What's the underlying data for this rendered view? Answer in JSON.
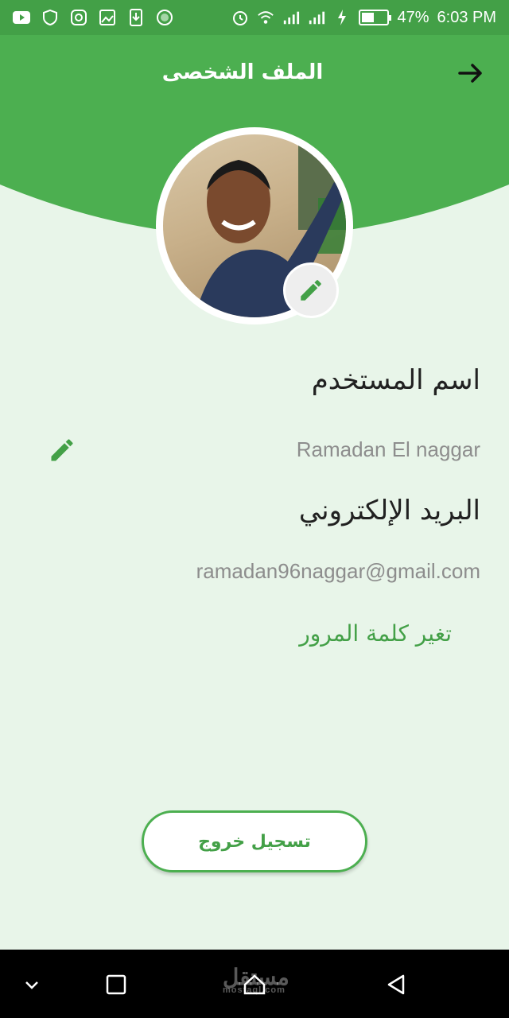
{
  "status_bar": {
    "battery_percent": "47%",
    "battery_level": 0.47,
    "time": "6:03 PM",
    "icons": [
      "youtube-icon",
      "shield-icon",
      "instagram-icon",
      "gallery-icon",
      "download-icon",
      "circle-app-icon"
    ],
    "right_icons": [
      "alarm-icon",
      "wifi-icon",
      "signal-icon",
      "signal-icon",
      "charging-icon",
      "battery-icon"
    ]
  },
  "header": {
    "title": "الملف الشخصى",
    "back_icon": "arrow-right-icon"
  },
  "profile": {
    "name_label": "اسم المستخدم",
    "name_value": "Ramadan El naggar",
    "email_label": "البريد الإلكتروني",
    "email_value": "ramadan96naggar@gmail.com",
    "change_password": "تغير كلمة المرور",
    "logout": "تسجيل خروج"
  },
  "navbar": {
    "watermark": "مستقل",
    "watermark_sub": "mostaql.com"
  },
  "colors": {
    "primary": "#4caf50",
    "status_bar": "#43a047",
    "background": "#e8f5e9",
    "text_dark": "#212121",
    "text_gray": "#8d8d8d"
  }
}
